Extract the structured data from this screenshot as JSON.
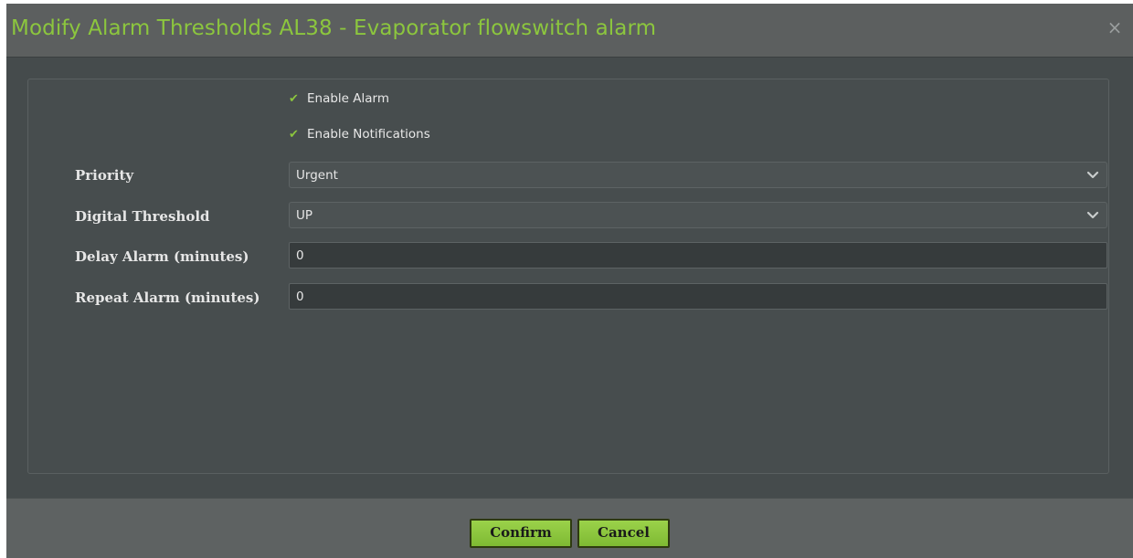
{
  "dialog": {
    "title": "Modify Alarm Thresholds AL38 - Evaporator flowswitch alarm",
    "close_glyph": "×"
  },
  "form": {
    "enable_alarm": {
      "label": "Enable Alarm",
      "checked": true
    },
    "enable_notifications": {
      "label": "Enable Notifications",
      "checked": true
    },
    "priority": {
      "label": "Priority",
      "value": "Urgent"
    },
    "digital_threshold": {
      "label": "Digital Threshold",
      "value": "UP"
    },
    "delay_alarm": {
      "label": "Delay Alarm (minutes)",
      "value": "0"
    },
    "repeat_alarm": {
      "label": "Repeat Alarm (minutes)",
      "value": "0"
    }
  },
  "footer": {
    "confirm_label": "Confirm",
    "cancel_label": "Cancel"
  },
  "colors": {
    "accent_green": "#8cc63e",
    "panel_bg": "#454b4c",
    "header_bg": "#5c5f5f"
  },
  "icons": {
    "check": "check-icon",
    "chevron": "chevron-down-icon",
    "close": "close-icon"
  }
}
